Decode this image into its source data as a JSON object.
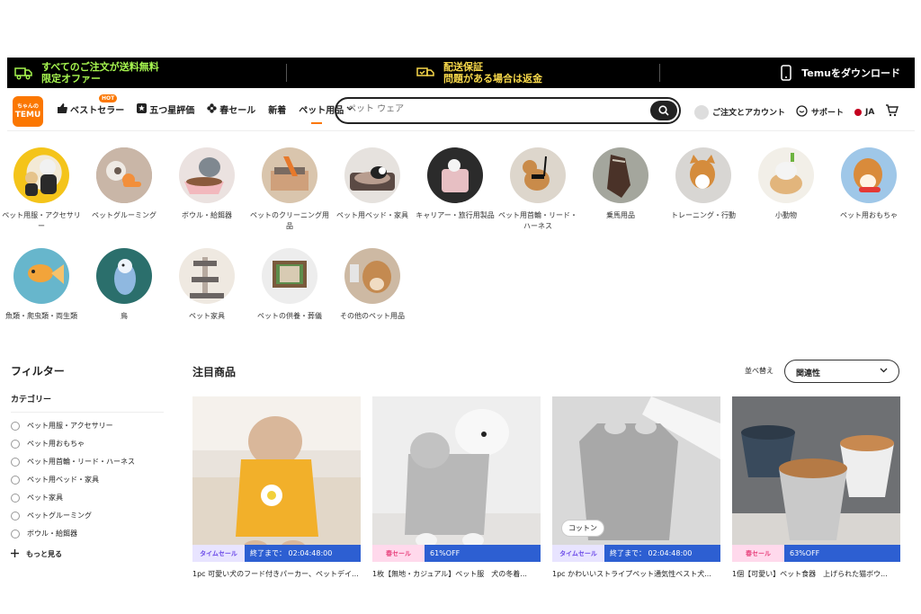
{
  "topbar": {
    "shipping_line1": "すべてのご注文が送料無料",
    "shipping_line2": "限定オファー",
    "guarantee_line1": "配送保証",
    "guarantee_line2": "問題がある場合は返金",
    "download": "Temuをダウンロード"
  },
  "header": {
    "logo_top": "ちゃんの",
    "logo": "TEMU",
    "nav": {
      "bestseller": "ベストセラー",
      "hot": "HOT",
      "five_star": "五つ星評価",
      "spring_sale": "春セール",
      "new": "新着",
      "pet_supplies": "ペット用品"
    },
    "search_placeholder": "ペット ウェア",
    "orders_account": "ご注文とアカウント",
    "support": "サポート",
    "language": "JA"
  },
  "categories": [
    {
      "label": "ペット用服・アクセサリー"
    },
    {
      "label": "ペットグルーミング"
    },
    {
      "label": "ボウル・給餌器"
    },
    {
      "label": "ペットのクリーニング用品"
    },
    {
      "label": "ペット用ベッド・家具"
    },
    {
      "label": "キャリアー・旅行用製品"
    },
    {
      "label": "ペット用首輪・リード・ハーネス"
    },
    {
      "label": "乗馬用品"
    },
    {
      "label": "トレーニング・行動"
    },
    {
      "label": "小動物"
    },
    {
      "label": "ペット用おもちゃ"
    },
    {
      "label": "魚類・爬虫類・両生類"
    },
    {
      "label": "鳥"
    },
    {
      "label": "ペット家具"
    },
    {
      "label": "ペットの供養・葬儀"
    },
    {
      "label": "その他のペット用品"
    }
  ],
  "filter": {
    "title": "フィルター",
    "category_heading": "カテゴリー",
    "options": [
      "ペット用服・アクセサリー",
      "ペット用おもちゃ",
      "ペット用首輪・リード・ハーネス",
      "ペット用ベッド・家具",
      "ペット家具",
      "ペットグルーミング",
      "ボウル・給餌器"
    ],
    "more": "もっと見る"
  },
  "products_section": {
    "title": "注目商品",
    "sort_label": "並べ替え",
    "sort_value": "関連性"
  },
  "products": [
    {
      "badge_left": "タイムセール",
      "badge_right": "終了まで： 02:04:48:00",
      "title": "1pc 可愛い犬のフード付きパーカー、ペットデイ..."
    },
    {
      "badge_left": "春セール",
      "badge_right": "61%OFF",
      "title": "1枚【無地・カジュアル】ペット服　犬の冬着..."
    },
    {
      "badge_left": "タイムセール",
      "badge_right": "終了まで： 02:04:48:00",
      "title": "1pc かわいいストライプペット通気性ベスト犬...",
      "tag": "コットン"
    },
    {
      "badge_left": "春セール",
      "badge_right": "63%OFF",
      "title": "1個【可愛い】ペット食器　上げられた猫ボウ..."
    }
  ]
}
